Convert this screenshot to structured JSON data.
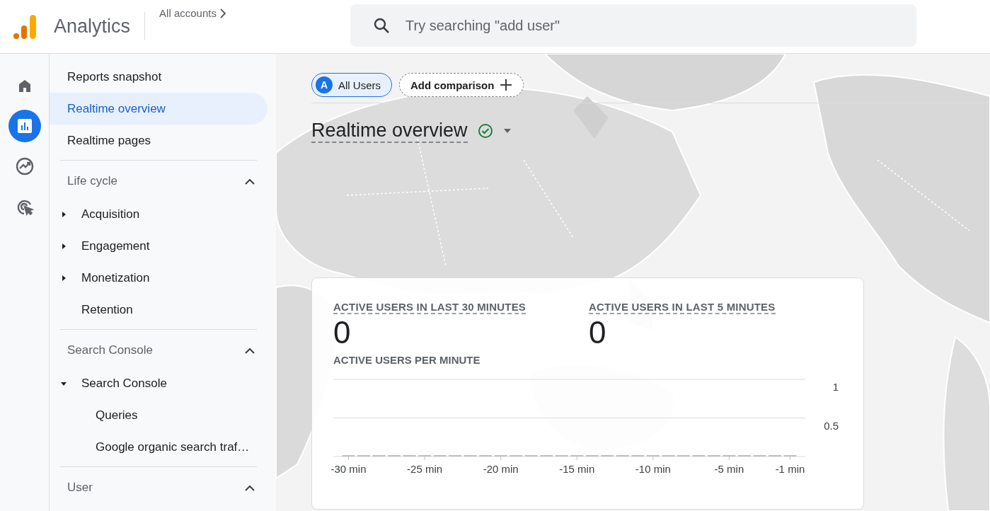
{
  "header": {
    "brand": "Analytics",
    "account": "All accounts",
    "search": {
      "placeholder": "Try searching \"add user\""
    }
  },
  "rail": [
    {
      "kind": "home",
      "selected": false
    },
    {
      "kind": "reports",
      "selected": true
    },
    {
      "kind": "explore",
      "selected": false
    },
    {
      "kind": "advertising",
      "selected": false
    }
  ],
  "nav": {
    "items": [
      {
        "label": "Reports snapshot",
        "selected": false
      },
      {
        "label": "Realtime overview",
        "selected": true
      },
      {
        "label": "Realtime pages",
        "selected": false
      }
    ],
    "groups": [
      {
        "title": "Life cycle",
        "expanded": true,
        "items": [
          {
            "label": "Acquisition",
            "kind": "folder",
            "expanded": false
          },
          {
            "label": "Engagement",
            "kind": "folder",
            "expanded": false
          },
          {
            "label": "Monetization",
            "kind": "folder",
            "expanded": false
          },
          {
            "label": "Retention",
            "kind": "page"
          }
        ]
      },
      {
        "title": "Search Console",
        "expanded": true,
        "items": [
          {
            "label": "Search Console",
            "kind": "folder",
            "expanded": true,
            "children": [
              {
                "label": "Queries"
              },
              {
                "label": "Google organic search traf…"
              }
            ]
          }
        ]
      },
      {
        "title": "User",
        "expanded": true
      }
    ]
  },
  "main": {
    "chips": [
      {
        "kind": "segment",
        "badge": "A",
        "label": "All Users"
      },
      {
        "kind": "add",
        "label": "Add comparison"
      }
    ],
    "title": "Realtime overview",
    "verified": true,
    "card": {
      "metrics": [
        {
          "label": "ACTIVE USERS IN LAST 30 MINUTES",
          "value": "0"
        },
        {
          "label": "ACTIVE USERS IN LAST 5 MINUTES",
          "value": "0"
        }
      ],
      "chart_title": "ACTIVE USERS PER MINUTE",
      "chart_data": {
        "type": "bar",
        "x": [
          -30,
          -29,
          -28,
          -27,
          -26,
          -25,
          -24,
          -23,
          -22,
          -21,
          -20,
          -19,
          -18,
          -17,
          -16,
          -15,
          -14,
          -13,
          -12,
          -11,
          -10,
          -9,
          -8,
          -7,
          -6,
          -5,
          -4,
          -3,
          -2,
          -1
        ],
        "series": [
          {
            "color": "#bdc1c6",
            "values": [
              0,
              0,
              0,
              0,
              0,
              0,
              0,
              0,
              0,
              0,
              0,
              0,
              0,
              0,
              0,
              0,
              0,
              0,
              0,
              0,
              0,
              0,
              0,
              0,
              0,
              0,
              0,
              0,
              0,
              0
            ]
          }
        ],
        "xlim": [
          -31,
          0
        ],
        "ylim": [
          0,
          1
        ],
        "yticks": [
          0.5,
          1
        ],
        "xticks": [
          {
            "value": -30,
            "label": "-30 min"
          },
          {
            "value": -25,
            "label": "-25 min"
          },
          {
            "value": -20,
            "label": "-20 min"
          },
          {
            "value": -15,
            "label": "-15 min"
          },
          {
            "value": -10,
            "label": "-10 min"
          },
          {
            "value": -5,
            "label": "-5 min"
          },
          {
            "value": -1,
            "label": "-1 min"
          }
        ]
      }
    }
  }
}
